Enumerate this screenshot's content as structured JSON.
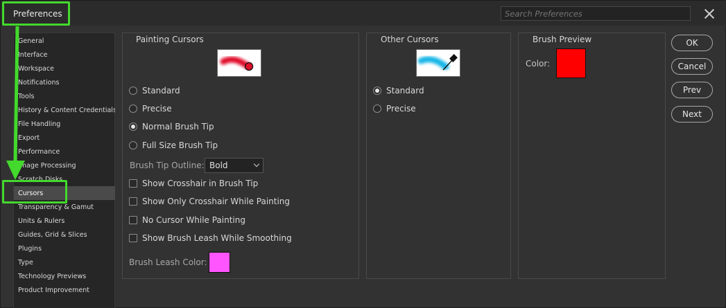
{
  "window": {
    "title": "Preferences",
    "search_placeholder": "Search Preferences"
  },
  "sidebar": {
    "items": [
      {
        "label": "General"
      },
      {
        "label": "Interface"
      },
      {
        "label": "Workspace"
      },
      {
        "label": "Notifications"
      },
      {
        "label": "Tools"
      },
      {
        "label": "History & Content Credentials"
      },
      {
        "label": "File Handling"
      },
      {
        "label": "Export"
      },
      {
        "label": "Performance"
      },
      {
        "label": "Image Processing"
      },
      {
        "label": "Scratch Disks"
      },
      {
        "label": "Cursors"
      },
      {
        "label": "Transparency & Gamut"
      },
      {
        "label": "Units & Rulers"
      },
      {
        "label": "Guides, Grid & Slices"
      },
      {
        "label": "Plugins"
      },
      {
        "label": "Type"
      },
      {
        "label": "Technology Previews"
      },
      {
        "label": "Product Improvement"
      }
    ],
    "selected": "Cursors"
  },
  "painting_cursors": {
    "title": "Painting Cursors",
    "options": [
      {
        "label": "Standard",
        "selected": false
      },
      {
        "label": "Precise",
        "selected": false
      },
      {
        "label": "Normal Brush Tip",
        "selected": true
      },
      {
        "label": "Full Size Brush Tip",
        "selected": false
      }
    ],
    "outline_label": "Brush Tip Outline:",
    "outline_value": "Bold",
    "checkboxes": [
      {
        "label": "Show Crosshair in Brush Tip",
        "checked": false
      },
      {
        "label": "Show Only Crosshair While Painting",
        "checked": false
      },
      {
        "label": "No Cursor While Painting",
        "checked": false
      },
      {
        "label": "Show Brush Leash While Smoothing",
        "checked": false
      }
    ],
    "leash_color_label": "Brush Leash Color:",
    "leash_color": "#ff55ff"
  },
  "other_cursors": {
    "title": "Other Cursors",
    "options": [
      {
        "label": "Standard",
        "selected": true
      },
      {
        "label": "Precise",
        "selected": false
      }
    ]
  },
  "brush_preview": {
    "title": "Brush Preview",
    "color_label": "Color:",
    "color": "#ff0000"
  },
  "buttons": {
    "ok": "OK",
    "cancel": "Cancel",
    "prev": "Prev",
    "next": "Next"
  },
  "annotation_color": "#43d92d"
}
